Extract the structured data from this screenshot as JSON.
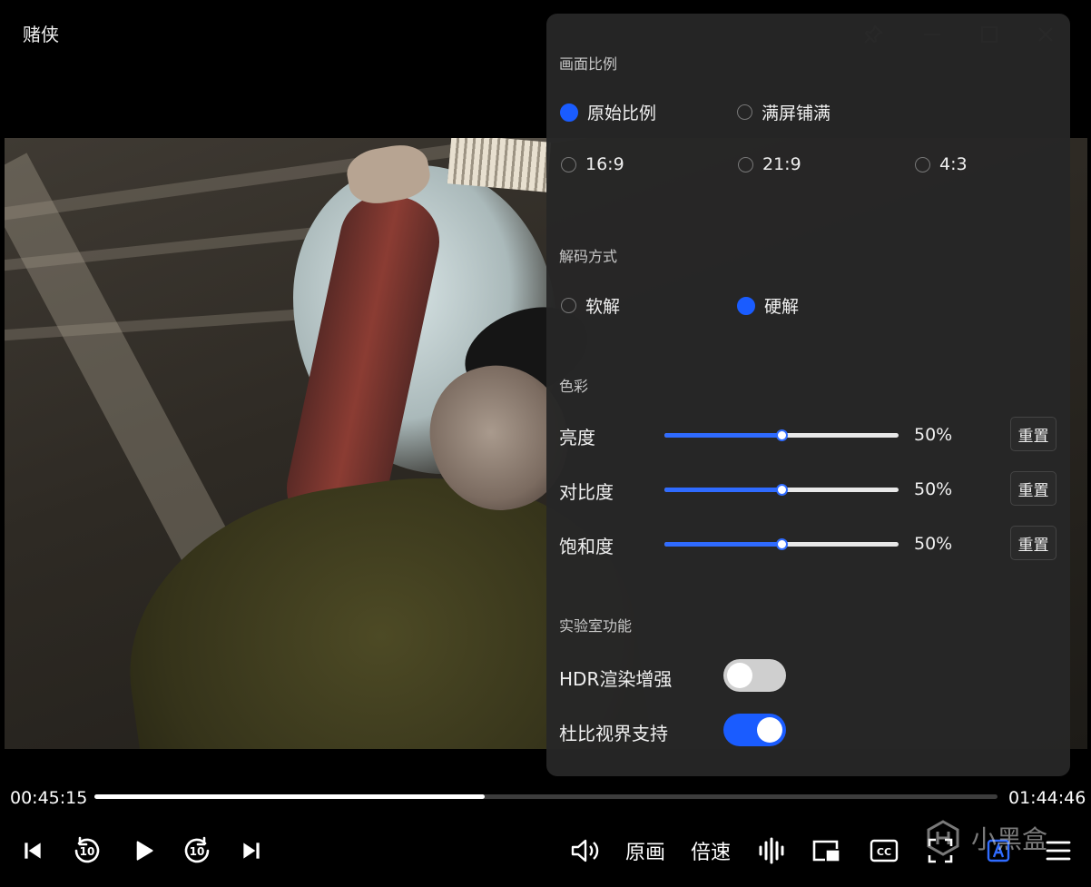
{
  "window": {
    "title": "赌侠"
  },
  "panel": {
    "aspect": {
      "title": "画面比例",
      "options": [
        {
          "label": "原始比例",
          "selected": true
        },
        {
          "label": "满屏铺满",
          "selected": false
        },
        {
          "label": "16:9",
          "selected": false
        },
        {
          "label": "21:9",
          "selected": false
        },
        {
          "label": "4:3",
          "selected": false
        }
      ]
    },
    "decode": {
      "title": "解码方式",
      "options": [
        {
          "label": "软解",
          "selected": false
        },
        {
          "label": "硬解",
          "selected": true
        }
      ]
    },
    "color": {
      "title": "色彩",
      "rows": [
        {
          "label": "亮度",
          "value": 0.5,
          "value_text": "50%",
          "reset": "重置"
        },
        {
          "label": "对比度",
          "value": 0.5,
          "value_text": "50%",
          "reset": "重置"
        },
        {
          "label": "饱和度",
          "value": 0.5,
          "value_text": "50%",
          "reset": "重置"
        }
      ]
    },
    "lab": {
      "title": "实验室功能",
      "toggles": [
        {
          "label": "HDR渲染增强",
          "on": false
        },
        {
          "label": "杜比视界支持",
          "on": true
        }
      ]
    }
  },
  "player": {
    "current_time": "00:45:15",
    "total_time": "01:44:46",
    "progress": 0.432,
    "quality_label": "原画",
    "speed_label": "倍速",
    "skip_back_seconds": "10",
    "skip_forward_seconds": "10"
  },
  "watermark": {
    "text": "小黑盒"
  },
  "colors": {
    "accent": "#1a5cff",
    "panel_bg": "#262626"
  }
}
